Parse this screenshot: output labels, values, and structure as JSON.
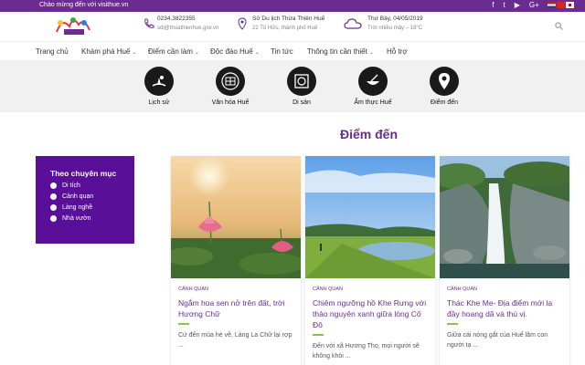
{
  "topbar": {
    "welcome": "Chào mừng đến với visithue.vn",
    "socials": [
      "f",
      "t",
      "▶",
      "G+",
      "in"
    ],
    "flags": [
      "#b22234",
      "#da251d",
      "#ffffff"
    ]
  },
  "header": {
    "phone": "0234.3822355",
    "email": "sdl@thuathienhue.gov.vn",
    "office": "Sở Du lịch Thừa Thiên Huế",
    "address": "22 Tố Hữu, thành phố Huế",
    "date": "Thứ Bảy, 04/05/2019",
    "weather": "Trời nhiều mây – 18°C"
  },
  "nav": [
    "Trang chủ",
    "Khám phá Huế",
    "Điểm cần làm",
    "Độc đáo Huế",
    "Tin tức",
    "Thông tin cần thiết",
    "Hỗ trợ"
  ],
  "categories": [
    {
      "label": "Lịch sử",
      "icon": "history-icon"
    },
    {
      "label": "Văn hóa Huế",
      "icon": "culture-icon"
    },
    {
      "label": "Di sản",
      "icon": "heritage-icon"
    },
    {
      "label": "Ẩm thực Huế",
      "icon": "cuisine-icon"
    },
    {
      "label": "Điểm đến",
      "icon": "location-pin-icon"
    }
  ],
  "section_title": "Điểm đến",
  "sidebar": {
    "title": "Theo chuyên mục",
    "items": [
      "Di tích",
      "Cảnh quan",
      "Làng nghề",
      "Nhà vườn"
    ]
  },
  "cards": [
    {
      "tag": "CẢNH QUAN",
      "title": "Ngắm hoa sen nở trên đất, trời Hương Chữ",
      "desc": "Cứ đến mùa hè về, Làng La Chữ lại rợp ..."
    },
    {
      "tag": "CẢNH QUAN",
      "title": "Chiêm ngưỡng hồ Khe Rưng với thảo nguyên xanh giữa lòng Cố Đô",
      "desc": "Đến với xã Hương Thọ, mọi người sẽ không khỏi ..."
    },
    {
      "tag": "CẢNH QUAN",
      "title": "Thác Khe Me- Địa điểm mới lạ đầy hoang dã và thú vị.",
      "desc": "Giữa cái nóng gắt của Huế lâm con người tạ ..."
    }
  ]
}
